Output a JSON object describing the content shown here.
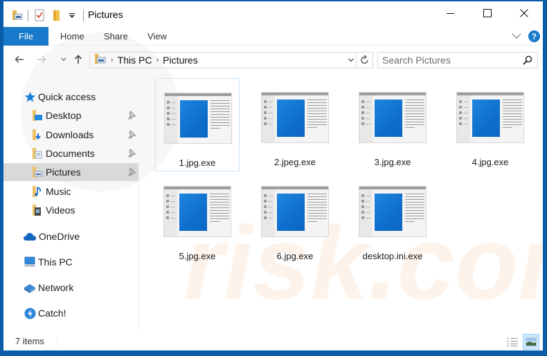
{
  "window": {
    "title": "Pictures",
    "controls": {
      "minimize": "minimize",
      "maximize": "maximize",
      "close": "close"
    }
  },
  "quick_access_toolbar": {
    "icons": [
      "properties-folder-icon",
      "checklist-icon",
      "new-folder-icon",
      "customize-dropdown-icon"
    ]
  },
  "ribbon": {
    "tabs": [
      {
        "label": "File",
        "active": true
      },
      {
        "label": "Home"
      },
      {
        "label": "Share"
      },
      {
        "label": "View"
      }
    ],
    "help_label": "?"
  },
  "address": {
    "breadcrumb": [
      "This PC",
      "Pictures"
    ],
    "search_placeholder": "Search Pictures"
  },
  "navigation": {
    "items": [
      {
        "label": "Quick access",
        "icon": "star-icon"
      },
      {
        "label": "Desktop",
        "icon": "desktop-folder-icon",
        "pinned": true
      },
      {
        "label": "Downloads",
        "icon": "downloads-folder-icon",
        "pinned": true
      },
      {
        "label": "Documents",
        "icon": "documents-folder-icon",
        "pinned": true
      },
      {
        "label": "Pictures",
        "icon": "pictures-folder-icon",
        "pinned": true,
        "selected": true
      },
      {
        "label": "Music",
        "icon": "music-folder-icon"
      },
      {
        "label": "Videos",
        "icon": "videos-folder-icon"
      },
      {
        "label": "OneDrive",
        "icon": "onedrive-icon"
      },
      {
        "label": "This PC",
        "icon": "this-pc-icon"
      },
      {
        "label": "Network",
        "icon": "network-icon"
      },
      {
        "label": "Catch!",
        "icon": "catch-icon"
      }
    ]
  },
  "files": [
    {
      "name": "1.jpg.exe",
      "selected": true
    },
    {
      "name": "2.jpeg.exe"
    },
    {
      "name": "3.jpg.exe"
    },
    {
      "name": "4.jpg.exe"
    },
    {
      "name": "5.jpg.exe"
    },
    {
      "name": "6.jpg.exe"
    },
    {
      "name": "desktop.ini.exe"
    }
  ],
  "status": {
    "item_count": "7 items",
    "view_modes": [
      "details-view",
      "large-icons-view"
    ],
    "active_view": "large-icons-view"
  },
  "colors": {
    "accent": "#1979ca",
    "window_border": "#0b5ca8",
    "selection": "#d9d9d9",
    "tile_selection_border": "#cce4f7"
  }
}
